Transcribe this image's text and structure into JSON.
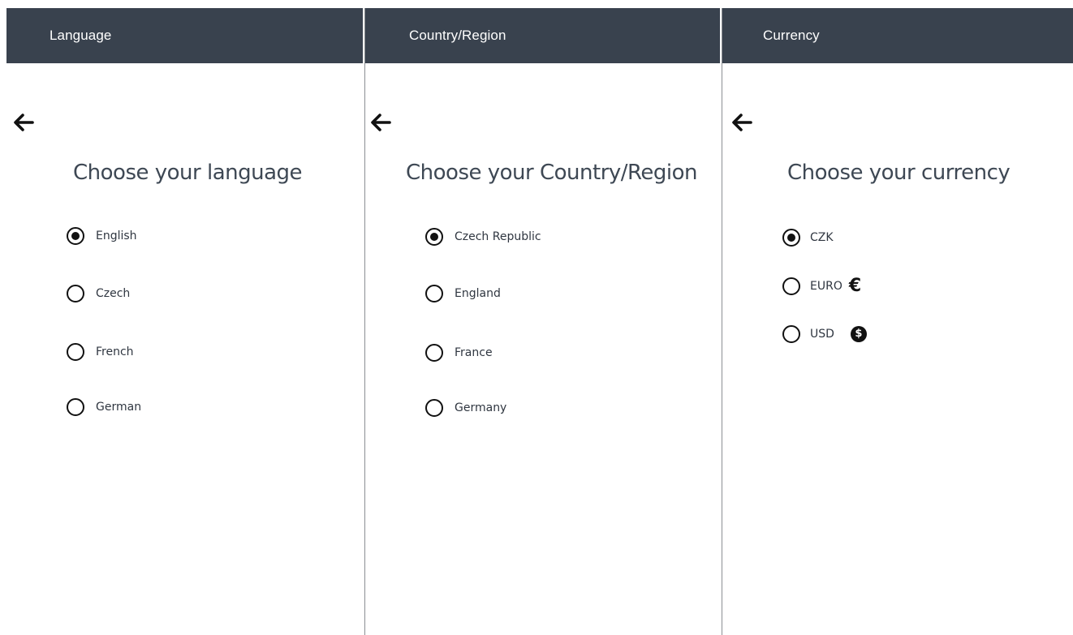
{
  "screens": {
    "language": {
      "title": "Language",
      "heading": "Choose your language",
      "options": [
        {
          "label": "English",
          "selected": true
        },
        {
          "label": "Czech",
          "selected": false
        },
        {
          "label": "French",
          "selected": false
        },
        {
          "label": "German",
          "selected": false
        }
      ]
    },
    "country": {
      "title": "Country/Region",
      "heading": "Choose your Country/Region",
      "options": [
        {
          "label": "Czech Republic",
          "selected": true
        },
        {
          "label": "England",
          "selected": false
        },
        {
          "label": "France",
          "selected": false
        },
        {
          "label": "Germany",
          "selected": false
        }
      ]
    },
    "currency": {
      "title": "Currency",
      "heading": "Choose your currency",
      "options": [
        {
          "label": "CZK",
          "selected": true,
          "icon": ""
        },
        {
          "label": "EURO",
          "selected": false,
          "icon": "euro-icon",
          "symbol": "€"
        },
        {
          "label": "USD",
          "selected": false,
          "icon": "dollar-circle-icon",
          "symbol": "$"
        }
      ]
    }
  },
  "icons": {
    "back": "arrow-left-icon"
  },
  "colors": {
    "topbar": "#39424e",
    "heading": "#3e4854",
    "radio": "#111111"
  }
}
